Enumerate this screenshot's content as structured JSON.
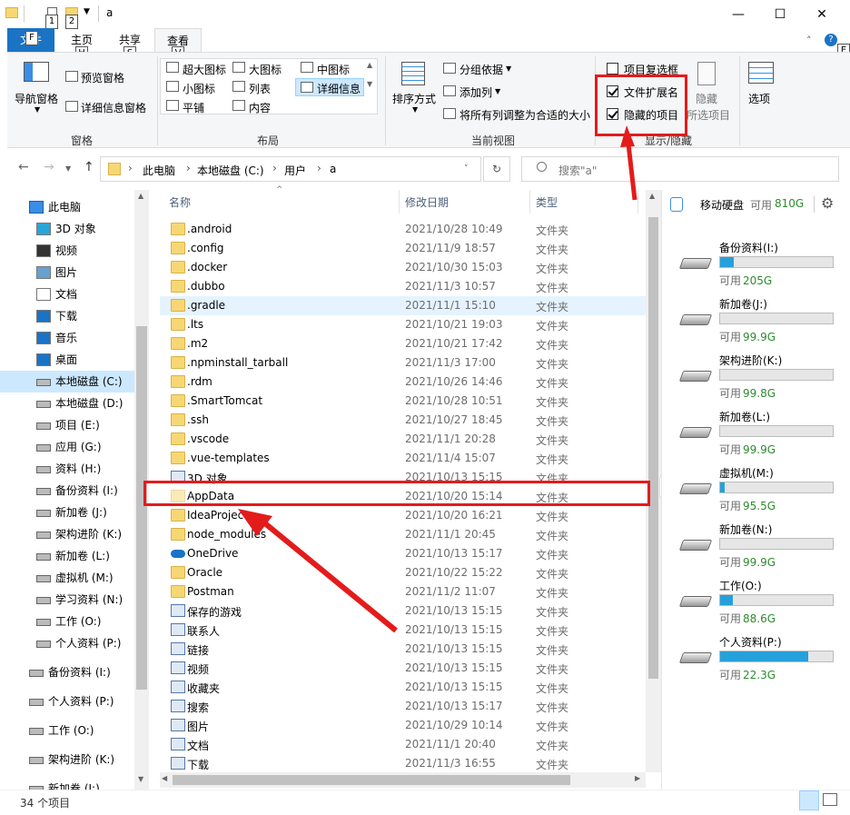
{
  "window": {
    "title": "a",
    "minimize": "—",
    "maximize": "☐",
    "close": "✕"
  },
  "qat": {
    "keytip1": "1",
    "keytip2": "2"
  },
  "tabs": [
    {
      "label": "文件",
      "keytip": "F"
    },
    {
      "label": "主页",
      "keytip": "H"
    },
    {
      "label": "共享",
      "keytip": "S"
    },
    {
      "label": "查看",
      "keytip": "V"
    }
  ],
  "ribbon": {
    "pane_group": {
      "label": "窗格",
      "nav_pane": "导航窗格",
      "preview_pane": "预览窗格",
      "details_pane": "详细信息窗格"
    },
    "layout_group": {
      "label": "布局",
      "items": [
        "超大图标",
        "大图标",
        "中图标",
        "小图标",
        "列表",
        "详细信息",
        "平铺",
        "内容"
      ]
    },
    "current_view_group": {
      "label": "当前视图",
      "sort": "排序方式",
      "group_by": "分组依据",
      "add_column": "添加列",
      "fit_columns": "将所有列调整为合适的大小"
    },
    "show_hide_group": {
      "label": "显示/隐藏",
      "item_checkbox": "项目复选框",
      "file_ext": "文件扩展名",
      "hidden_items": "隐藏的项目",
      "hide_selected": "隐藏",
      "hide_selected2": "所选项目",
      "options": "选项"
    }
  },
  "address": {
    "crumbs": [
      "此电脑",
      "本地磁盘 (C:)",
      "用户",
      "a"
    ],
    "search_placeholder": "搜索\"a\""
  },
  "nav": [
    "此电脑",
    "3D 对象",
    "视频",
    "图片",
    "文档",
    "下载",
    "音乐",
    "桌面",
    "本地磁盘 (C:)",
    "本地磁盘 (D:)",
    "项目 (E:)",
    "应用 (G:)",
    "资料 (H:)",
    "备份资料 (I:)",
    "新加卷 (J:)",
    "架构进阶 (K:)",
    "新加卷 (L:)",
    "虚拟机 (M:)",
    "学习资料 (N:)",
    "工作 (O:)",
    "个人资料 (P:)",
    "备份资料 (I:)",
    "个人资料 (P:)",
    "工作 (O:)",
    "架构进阶 (K:)",
    "新加卷 (J:)"
  ],
  "columns": {
    "name": "名称",
    "date": "修改日期",
    "type": "类型"
  },
  "files": [
    {
      "name": ".android",
      "date": "2021/10/28 10:49",
      "type": "文件夹",
      "icon": "folder-icon"
    },
    {
      "name": ".config",
      "date": "2021/11/9 18:57",
      "type": "文件夹",
      "icon": "folder-icon"
    },
    {
      "name": ".docker",
      "date": "2021/10/30 15:03",
      "type": "文件夹",
      "icon": "folder-icon"
    },
    {
      "name": ".dubbo",
      "date": "2021/11/3 10:57",
      "type": "文件夹",
      "icon": "folder-icon"
    },
    {
      "name": ".gradle",
      "date": "2021/11/1 15:10",
      "type": "文件夹",
      "icon": "folder-icon"
    },
    {
      "name": ".lts",
      "date": "2021/10/21 19:03",
      "type": "文件夹",
      "icon": "folder-icon"
    },
    {
      "name": ".m2",
      "date": "2021/10/21 17:42",
      "type": "文件夹",
      "icon": "folder-icon"
    },
    {
      "name": ".npminstall_tarball",
      "date": "2021/11/3 17:00",
      "type": "文件夹",
      "icon": "folder-icon"
    },
    {
      "name": ".rdm",
      "date": "2021/10/26 14:46",
      "type": "文件夹",
      "icon": "folder-icon"
    },
    {
      "name": ".SmartTomcat",
      "date": "2021/10/28 10:51",
      "type": "文件夹",
      "icon": "folder-icon"
    },
    {
      "name": ".ssh",
      "date": "2021/10/27 18:45",
      "type": "文件夹",
      "icon": "folder-icon"
    },
    {
      "name": ".vscode",
      "date": "2021/11/1 20:28",
      "type": "文件夹",
      "icon": "folder-icon"
    },
    {
      "name": ".vue-templates",
      "date": "2021/11/4 15:07",
      "type": "文件夹",
      "icon": "folder-icon"
    },
    {
      "name": "3D 对象",
      "date": "2021/10/13 15:15",
      "type": "文件夹",
      "icon": "3d-objects-icon"
    },
    {
      "name": "AppData",
      "date": "2021/10/20 15:14",
      "type": "文件夹",
      "icon": "hidden-folder-icon"
    },
    {
      "name": "IdeaProjects",
      "date": "2021/10/20 16:21",
      "type": "文件夹",
      "icon": "folder-icon"
    },
    {
      "name": "node_modules",
      "date": "2021/11/1 20:45",
      "type": "文件夹",
      "icon": "folder-icon"
    },
    {
      "name": "OneDrive",
      "date": "2021/10/13 15:17",
      "type": "文件夹",
      "icon": "onedrive-icon"
    },
    {
      "name": "Oracle",
      "date": "2021/10/22 15:22",
      "type": "文件夹",
      "icon": "folder-icon"
    },
    {
      "name": "Postman",
      "date": "2021/11/2 11:07",
      "type": "文件夹",
      "icon": "folder-icon"
    },
    {
      "name": "保存的游戏",
      "date": "2021/10/13 15:15",
      "type": "文件夹",
      "icon": "saved-games-icon"
    },
    {
      "name": "联系人",
      "date": "2021/10/13 15:15",
      "type": "文件夹",
      "icon": "contacts-icon"
    },
    {
      "name": "链接",
      "date": "2021/10/13 15:15",
      "type": "文件夹",
      "icon": "links-icon"
    },
    {
      "name": "视频",
      "date": "2021/10/13 15:15",
      "type": "文件夹",
      "icon": "videos-icon"
    },
    {
      "name": "收藏夹",
      "date": "2021/10/13 15:15",
      "type": "文件夹",
      "icon": "favorites-icon"
    },
    {
      "name": "搜索",
      "date": "2021/10/13 15:17",
      "type": "文件夹",
      "icon": "searches-icon"
    },
    {
      "name": "图片",
      "date": "2021/10/29 10:14",
      "type": "文件夹",
      "icon": "pictures-icon"
    },
    {
      "name": "文档",
      "date": "2021/11/1 20:40",
      "type": "文件夹",
      "icon": "documents-icon"
    },
    {
      "name": "下载",
      "date": "2021/11/3 16:55",
      "type": "文件夹",
      "icon": "downloads-icon"
    }
  ],
  "drives_panel": {
    "title": "移动硬盘",
    "free_prefix": "可用",
    "free_total": "810G",
    "drives": [
      {
        "name": "备份资料(I:)",
        "free": "205G",
        "used_fraction": 0.12
      },
      {
        "name": "新加卷(J:)",
        "free": "99.9G",
        "used_fraction": 0.0
      },
      {
        "name": "架构进阶(K:)",
        "free": "99.8G",
        "used_fraction": 0.0
      },
      {
        "name": "新加卷(L:)",
        "free": "99.9G",
        "used_fraction": 0.0
      },
      {
        "name": "虚拟机(M:)",
        "free": "95.5G",
        "used_fraction": 0.04
      },
      {
        "name": "新加卷(N:)",
        "free": "99.9G",
        "used_fraction": 0.0
      },
      {
        "name": "工作(O:)",
        "free": "88.6G",
        "used_fraction": 0.11
      },
      {
        "name": "个人资料(P:)",
        "free": "22.3G",
        "used_fraction": 0.78
      }
    ]
  },
  "status": {
    "count": "34 个项目"
  },
  "colors": {
    "accent": "#1a73c4",
    "annotation": "#e41b1b",
    "selection": "#cce8ff",
    "hover": "#e5f3ff"
  }
}
